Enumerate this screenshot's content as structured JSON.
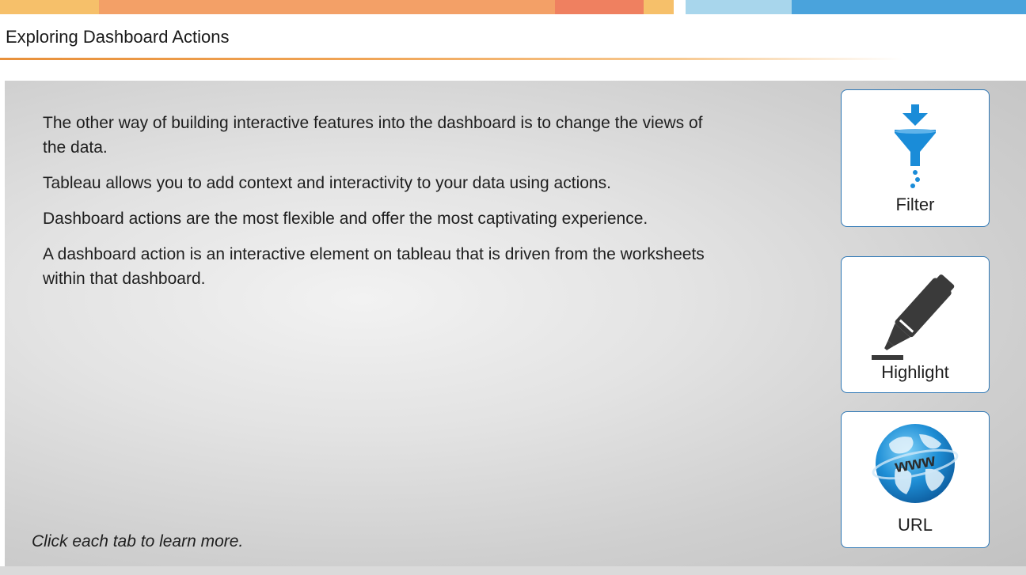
{
  "header": {
    "title": "Exploring Dashboard Actions"
  },
  "colors": {
    "stripe_orange_light": "#f6c06a",
    "stripe_orange": "#f3a067",
    "stripe_red": "#ef8060",
    "stripe_blue_light": "#a8d6ec",
    "stripe_blue": "#4aa3dc",
    "tab_border": "#2e77b5",
    "accent_blue": "#1a8cd8"
  },
  "main": {
    "paragraphs": [
      "The other way of building interactive features into the dashboard is to change the views of the data.",
      "Tableau allows you to add context and interactivity to your data using actions.",
      "Dashboard actions are the most flexible and offer the most captivating experience.",
      "A dashboard action is an interactive element on tableau that is driven from the worksheets within that dashboard."
    ],
    "hint": "Click each tab to learn more."
  },
  "tabs": [
    {
      "label": "Filter",
      "icon": "funnel-filter-icon"
    },
    {
      "label": "Highlight",
      "icon": "highlighter-pen-icon"
    },
    {
      "label": "URL",
      "icon": "globe-www-icon",
      "icon_text": "www"
    }
  ]
}
